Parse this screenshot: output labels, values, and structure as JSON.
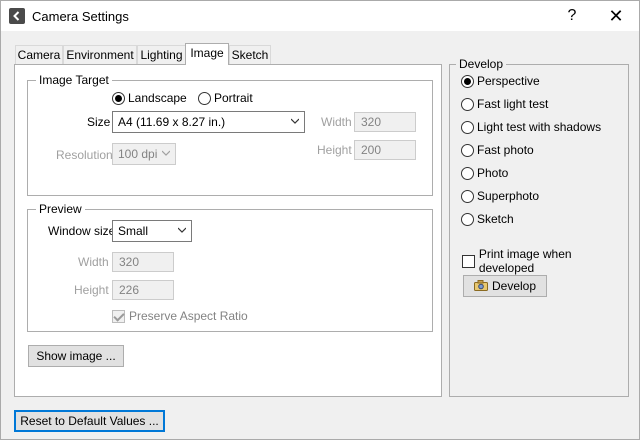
{
  "window": {
    "title": "Camera Settings",
    "help_glyph": "?",
    "close_glyph": "✕"
  },
  "tabs": [
    {
      "label": "Camera",
      "active": false
    },
    {
      "label": "Environment",
      "active": false
    },
    {
      "label": "Lighting",
      "active": false
    },
    {
      "label": "Image",
      "active": true
    },
    {
      "label": "Sketch",
      "active": false
    }
  ],
  "image_target": {
    "legend": "Image Target",
    "orientation": [
      {
        "label": "Landscape",
        "selected": true
      },
      {
        "label": "Portrait",
        "selected": false
      }
    ],
    "size_label": "Size",
    "size_value": "A4 (11.69 x 8.27 in.)",
    "resolution_label": "Resolution",
    "resolution_value": "100 dpi",
    "width_label": "Width",
    "width_value": "320",
    "height_label": "Height",
    "height_value": "200"
  },
  "preview": {
    "legend": "Preview",
    "window_size_label": "Window size",
    "window_size_value": "Small",
    "width_label": "Width",
    "width_value": "320",
    "height_label": "Height",
    "height_value": "226",
    "preserve_aspect_label": "Preserve Aspect Ratio",
    "preserve_aspect_checked": true
  },
  "show_image_button": "Show image ...",
  "develop": {
    "legend": "Develop",
    "options": [
      {
        "label": "Perspective",
        "selected": true
      },
      {
        "label": "Fast light test",
        "selected": false
      },
      {
        "label": "Light test with shadows",
        "selected": false
      },
      {
        "label": "Fast photo",
        "selected": false
      },
      {
        "label": "Photo",
        "selected": false
      },
      {
        "label": "Superphoto",
        "selected": false
      },
      {
        "label": "Sketch",
        "selected": false
      }
    ],
    "print_label": "Print image when developed",
    "print_checked": false,
    "develop_button": "Develop"
  },
  "reset_button": "Reset to Default Values ..."
}
